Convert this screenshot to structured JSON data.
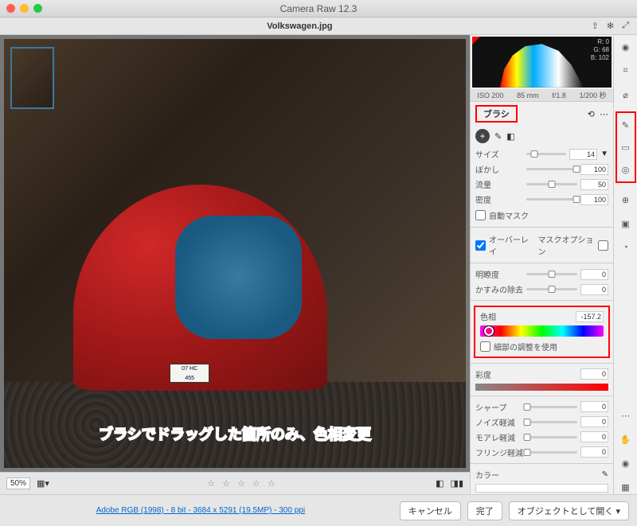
{
  "app": {
    "title": "Camera Raw 12.3"
  },
  "file": {
    "name": "Volkswagen.jpg"
  },
  "histogram": {
    "r": "R: 0",
    "g": "G: 68",
    "b": "B: 102"
  },
  "exif": {
    "iso": "ISO 200",
    "focal": "85 mm",
    "aperture": "f/1.8",
    "shutter": "1/200 秒"
  },
  "brush": {
    "title": "ブラシ",
    "size": {
      "label": "サイズ",
      "value": "14"
    },
    "feather": {
      "label": "ぼかし",
      "value": "100"
    },
    "flow": {
      "label": "流量",
      "value": "50"
    },
    "density": {
      "label": "密度",
      "value": "100"
    },
    "automask": {
      "label": "自動マスク"
    }
  },
  "options": {
    "overlay": {
      "label": "オーバーレイ"
    },
    "mask_option": {
      "label": "マスクオプション"
    }
  },
  "adjust": {
    "clarity": {
      "label": "明瞭度",
      "value": "0"
    },
    "dehaze": {
      "label": "かすみの除去",
      "value": "0"
    },
    "hue": {
      "label": "色相",
      "value": "-157.2"
    },
    "fine_adjust": {
      "label": "細部の調整を使用"
    },
    "saturation": {
      "label": "彩度",
      "value": "0"
    },
    "sharpen": {
      "label": "シャープ",
      "value": "0"
    },
    "noise": {
      "label": "ノイズ軽減",
      "value": "0"
    },
    "moire": {
      "label": "モアレ軽減",
      "value": "0"
    },
    "fringe": {
      "label": "フリンジ軽減",
      "value": "0"
    },
    "color": {
      "label": "カラー"
    }
  },
  "plate": {
    "top": "07  HC",
    "bottom": "455"
  },
  "annotation": "ブラシでドラッグした箇所のみ、色相変更",
  "zoom": "50%",
  "stars": "☆ ☆ ☆ ☆ ☆",
  "meta": "Adobe RGB (1998) - 8 bit - 3684 x 5291 (19.5MP) - 300 ppi",
  "buttons": {
    "cancel": "キャンセル",
    "done": "完了",
    "open": "オブジェクトとして開く"
  }
}
